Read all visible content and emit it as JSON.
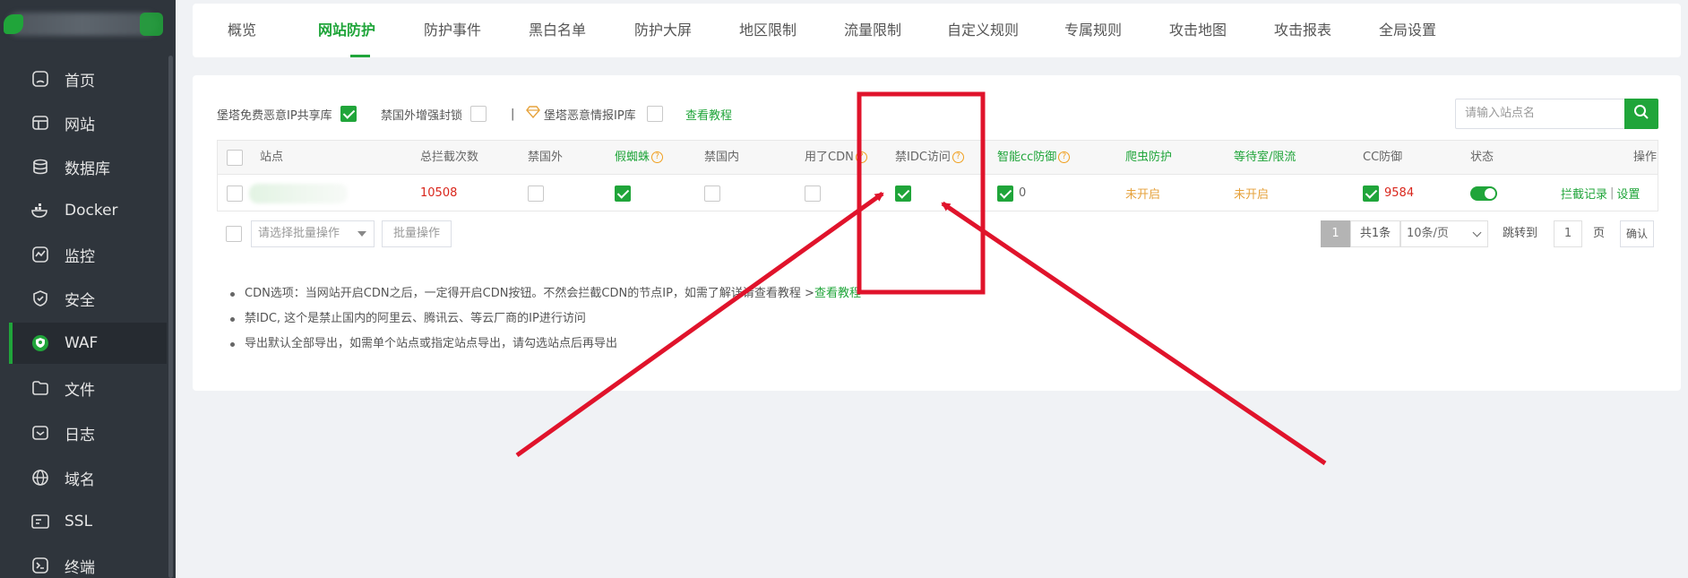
{
  "sidebar": {
    "items": [
      {
        "label": "首页",
        "icon": "home-icon"
      },
      {
        "label": "网站",
        "icon": "website-icon"
      },
      {
        "label": "数据库",
        "icon": "database-icon"
      },
      {
        "label": "Docker",
        "icon": "docker-icon"
      },
      {
        "label": "监控",
        "icon": "monitor-icon"
      },
      {
        "label": "安全",
        "icon": "shield-icon"
      },
      {
        "label": "WAF",
        "icon": "waf-icon",
        "active": true
      },
      {
        "label": "文件",
        "icon": "folder-icon"
      },
      {
        "label": "日志",
        "icon": "log-icon"
      },
      {
        "label": "域名",
        "icon": "globe-icon"
      },
      {
        "label": "SSL",
        "icon": "ssl-icon"
      },
      {
        "label": "终端",
        "icon": "terminal-icon"
      }
    ]
  },
  "tabs": [
    "概览",
    "网站防护",
    "防护事件",
    "黑白名单",
    "防护大屏",
    "地区限制",
    "流量限制",
    "自定义规则",
    "专属规则",
    "攻击地图",
    "攻击报表",
    "全局设置"
  ],
  "active_tab": "网站防护",
  "options": {
    "shared_ip": "堡塔免费恶意IP共享库",
    "foreign_block": "禁国外增强封锁",
    "separator": "|",
    "intel_ip": "堡塔恶意情报IP库",
    "tutorial": "查看教程"
  },
  "search": {
    "placeholder": "请输入站点名"
  },
  "table": {
    "headers": {
      "site": "站点",
      "total": "总拦截次数",
      "foreign": "禁国外",
      "spider": "假蜘蛛",
      "domestic": "禁国内",
      "cdn": "用了CDN",
      "idc": "禁IDC访问",
      "smart_cc": "智能cc防御",
      "crawler": "爬虫防护",
      "waiting": "等待室/限流",
      "cc": "CC防御",
      "status": "状态",
      "ops": "操作"
    },
    "help_mark": "?",
    "row": {
      "total": "10508",
      "smart_cc_count": "0",
      "crawler": "未开启",
      "waiting": "未开启",
      "cc_count": "9584",
      "op_log": "拦截记录",
      "op_sep": "|",
      "op_set": "设置"
    }
  },
  "batch": {
    "placeholder": "请选择批量操作",
    "button": "批量操作"
  },
  "pager": {
    "current": "1",
    "total": "共1条",
    "page_size": "10条/页",
    "goto": "跳转到",
    "goto_value": "1",
    "unit": "页",
    "confirm": "确认"
  },
  "notes": [
    {
      "text": "CDN选项：当网站开启CDN之后，一定得开启CDN按钮。不然会拦截CDN的节点IP，如需了解详请查看教程 >",
      "link": "查看教程"
    },
    {
      "text": "禁IDC, 这个是禁止国内的阿里云、腾讯云、等云厂商的IP进行访问",
      "link": ""
    },
    {
      "text": "导出默认全部导出，如需单个站点或指定站点导出，请勾选站点后再导出",
      "link": ""
    }
  ],
  "colors": {
    "brand": "#20a53a",
    "annotation": "#e0132b",
    "danger": "#d9261c",
    "warning": "#e6a23c"
  }
}
